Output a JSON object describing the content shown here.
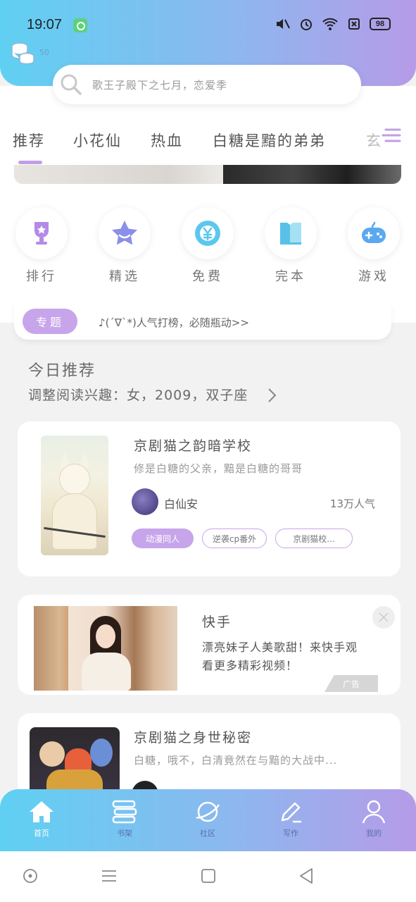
{
  "status_bar": {
    "time": "19:07",
    "battery": "98"
  },
  "header": {
    "coin_count": "50"
  },
  "search": {
    "placeholder": "歌王子殿下之七月，恋爱季"
  },
  "tabs": [
    {
      "label": "推荐",
      "active": true
    },
    {
      "label": "小花仙",
      "active": false
    },
    {
      "label": "热血",
      "active": false
    },
    {
      "label": "白糖是黯的弟弟",
      "active": false
    },
    {
      "label": "玄",
      "active": false
    }
  ],
  "categories": [
    {
      "label": "排行",
      "icon": "trophy-icon"
    },
    {
      "label": "精选",
      "icon": "star-icon"
    },
    {
      "label": "免费",
      "icon": "yen-coin-icon"
    },
    {
      "label": "完本",
      "icon": "book-icon"
    },
    {
      "label": "游戏",
      "icon": "gamepad-icon"
    }
  ],
  "topic": {
    "badge": "专题",
    "text": "♪(´∇`*)人气打榜，必随瓶动>>"
  },
  "recommend": {
    "title": "今日推荐",
    "subtitle": "调整阅读兴趣：女，2009，双子座"
  },
  "book1": {
    "title": "京剧猫之韵暗学校",
    "desc": "修是白糖的父亲，黯是白糖的哥哥",
    "author": "白仙安",
    "popularity": "13万人气",
    "tags": [
      "动漫同人",
      "逆袭cp番外",
      "京剧猫校..."
    ]
  },
  "ad": {
    "title": "快手",
    "desc": "漂亮妹子人美歌甜！来快手观看更多精彩视频！",
    "label": "广告"
  },
  "book2": {
    "title": "京剧猫之身世秘密",
    "desc": "白糖，哦不，白清竟然在与黯的大战中..."
  },
  "bottom_nav": [
    {
      "label": "首页",
      "icon": "home-icon",
      "active": true
    },
    {
      "label": "书架",
      "icon": "bookshelf-icon",
      "active": false
    },
    {
      "label": "社区",
      "icon": "planet-icon",
      "active": false
    },
    {
      "label": "写作",
      "icon": "pen-icon",
      "active": false
    },
    {
      "label": "我的",
      "icon": "profile-icon",
      "active": false
    }
  ],
  "colors": {
    "gradient_start": "#5fd0f2",
    "gradient_end": "#b69be8",
    "accent_purple": "#c7a5ea"
  }
}
